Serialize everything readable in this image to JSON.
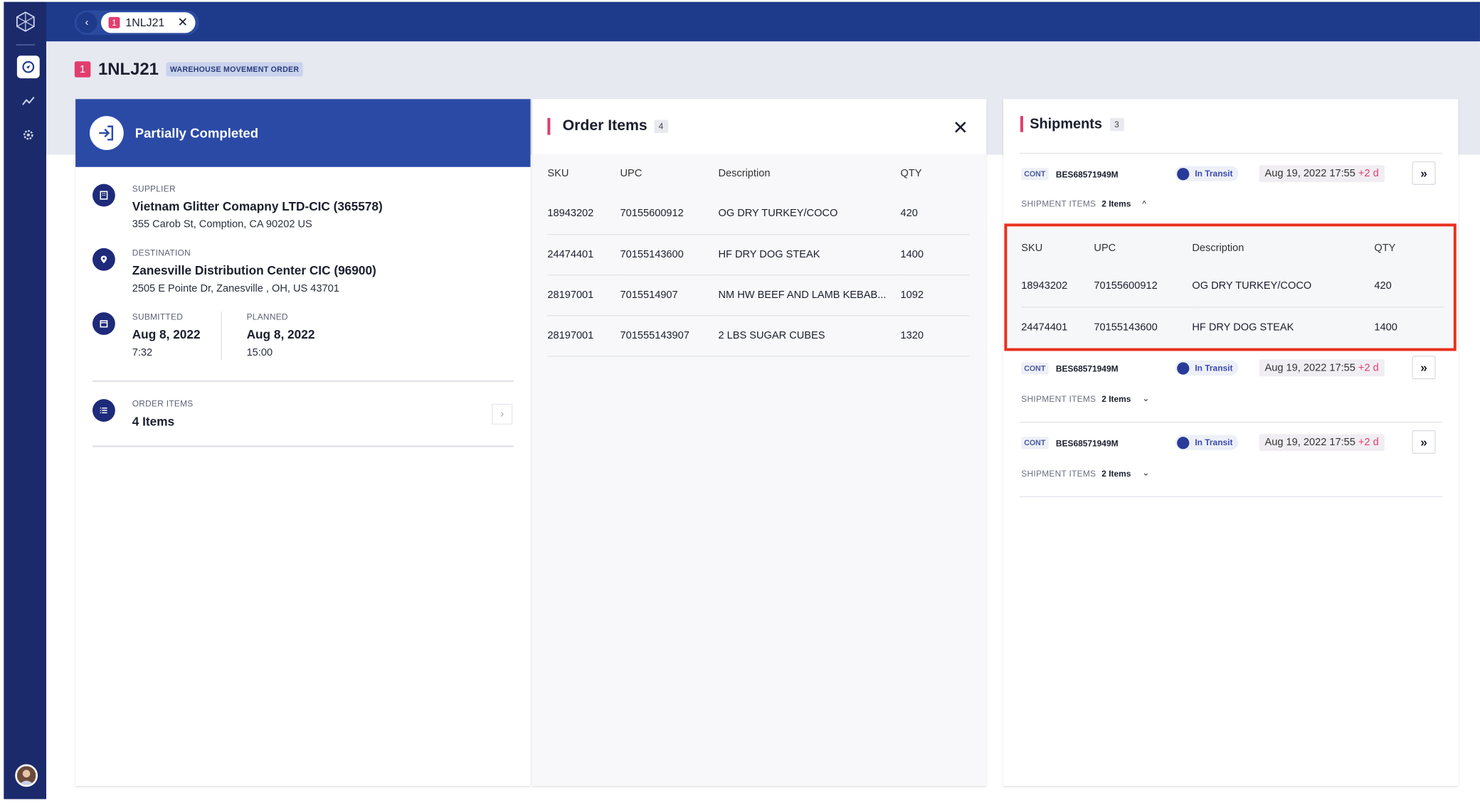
{
  "tab": {
    "badge": "1",
    "label": "1NLJ21"
  },
  "header": {
    "badge": "1",
    "title": "1NLJ21",
    "type": "WAREHOUSE MOVEMENT ORDER"
  },
  "status": {
    "label": "Partially Completed"
  },
  "supplier": {
    "label": "SUPPLIER",
    "name": "Vietnam Glitter Comapny LTD-CIC (365578)",
    "address": "355 Carob St, Comption, CA 90202 US"
  },
  "destination": {
    "label": "DESTINATION",
    "name": "Zanesville Distribution Center CIC (96900)",
    "address": "2505 E Pointe Dr, Zanesville , OH, US 43701"
  },
  "submitted": {
    "label": "SUBMITTED",
    "date": "Aug 8, 2022",
    "time": "7:32"
  },
  "planned": {
    "label": "PLANNED",
    "date": "Aug 8, 2022",
    "time": "15:00"
  },
  "order_items_summary": {
    "label": "ORDER ITEMS",
    "value": "4 Items"
  },
  "order_items_panel": {
    "title": "Order Items",
    "count": "4",
    "columns": [
      "SKU",
      "UPC",
      "Description",
      "QTY"
    ],
    "rows": [
      [
        "18943202",
        "70155600912",
        "OG DRY TURKEY/COCO",
        "420"
      ],
      [
        "24474401",
        "70155143600",
        "HF DRY DOG STEAK",
        "1400"
      ],
      [
        "28197001",
        "7015514907",
        "NM HW BEEF AND LAMB KEBAB...",
        "1092"
      ],
      [
        "28197001",
        "701555143907",
        "2 LBS SUGAR CUBES",
        "1320"
      ]
    ]
  },
  "shipments_panel": {
    "title": "Shipments",
    "count": "3",
    "items": [
      {
        "type": "CONT",
        "id": "BES68571949M",
        "status": "In Transit",
        "date": "Aug 19, 2022 17:55",
        "delta": "+2 d",
        "items_label": "SHIPMENT ITEMS",
        "items_value": "2 Items",
        "chevron": "^"
      },
      {
        "type": "CONT",
        "id": "BES68571949M",
        "status": "In Transit",
        "date": "Aug 19, 2022 17:55",
        "delta": "+2 d",
        "items_label": "SHIPMENT ITEMS",
        "items_value": "2 Items",
        "chevron": "⌄"
      },
      {
        "type": "CONT",
        "id": "BES68571949M",
        "status": "In Transit",
        "date": "Aug 19, 2022 17:55",
        "delta": "+2 d",
        "items_label": "SHIPMENT ITEMS",
        "items_value": "2 Items",
        "chevron": "⌄"
      }
    ],
    "expanded_table": {
      "columns": [
        "SKU",
        "UPC",
        "Description",
        "QTY"
      ],
      "rows": [
        [
          "18943202",
          "70155600912",
          "OG DRY TURKEY/COCO",
          "420"
        ],
        [
          "24474401",
          "70155143600",
          "HF DRY DOG STEAK",
          "1400"
        ]
      ]
    }
  },
  "colors": {
    "sidebar": "#1b2a6b",
    "topbar": "#1e3a8a",
    "status_banner": "#2a4aa6",
    "accent": "#e23d6f",
    "highlight": "#e8321f"
  }
}
